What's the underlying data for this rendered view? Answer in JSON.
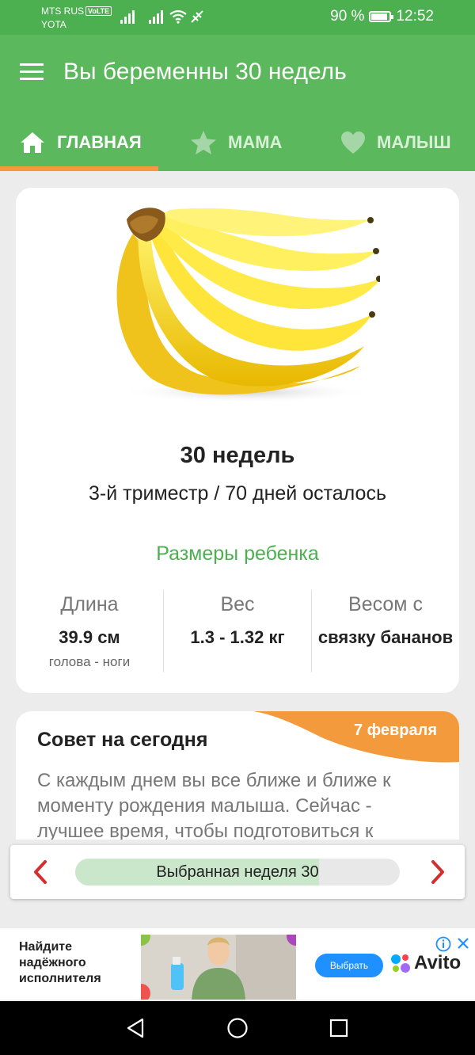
{
  "status_bar": {
    "carrier_1": "MTS RUS",
    "volte": "VoLTE",
    "carrier_2": "YOTA",
    "battery_percent": "90 %",
    "battery_level": 0.9,
    "time": "12:52"
  },
  "app_bar": {
    "title": "Вы беременны 30 недель",
    "tabs": [
      {
        "label": "ГЛАВНАЯ",
        "icon": "home-icon",
        "active": true
      },
      {
        "label": "МАМА",
        "icon": "star-icon",
        "active": false
      },
      {
        "label": "МАЛЫШ",
        "icon": "heart-icon",
        "active": false
      }
    ]
  },
  "week_card": {
    "image": "bananas",
    "weeks": "30 недель",
    "trimester_info": "3-й триместр / 70 дней осталось",
    "sizes_title": "Размеры ребенка",
    "columns": [
      {
        "label": "Длина",
        "value": "39.9 см",
        "sub": "голова - ноги"
      },
      {
        "label": "Вес",
        "value": "1.3 - 1.32 кг",
        "sub": ""
      },
      {
        "label": "Весом с",
        "value": "связку бананов",
        "sub": ""
      }
    ]
  },
  "tip_card": {
    "title": "Совет на сегодня",
    "date": "7 февраля",
    "text": "С каждым днем вы все ближе и ближе к моменту рождения малыша. Сейчас - лучшее время, чтобы подготовиться к"
  },
  "week_selector": {
    "label": "Выбранная неделя 30",
    "progress": 0.75
  },
  "ad": {
    "text_line_1": "Найдите",
    "text_line_2": "надёжного",
    "text_line_3": "исполнителя",
    "button": "Выбрать",
    "brand": "Avito"
  },
  "colors": {
    "primary": "#5cb85c",
    "status_bar": "#4caf50",
    "accent": "#f39a3c",
    "arrow": "#d32f2f"
  }
}
